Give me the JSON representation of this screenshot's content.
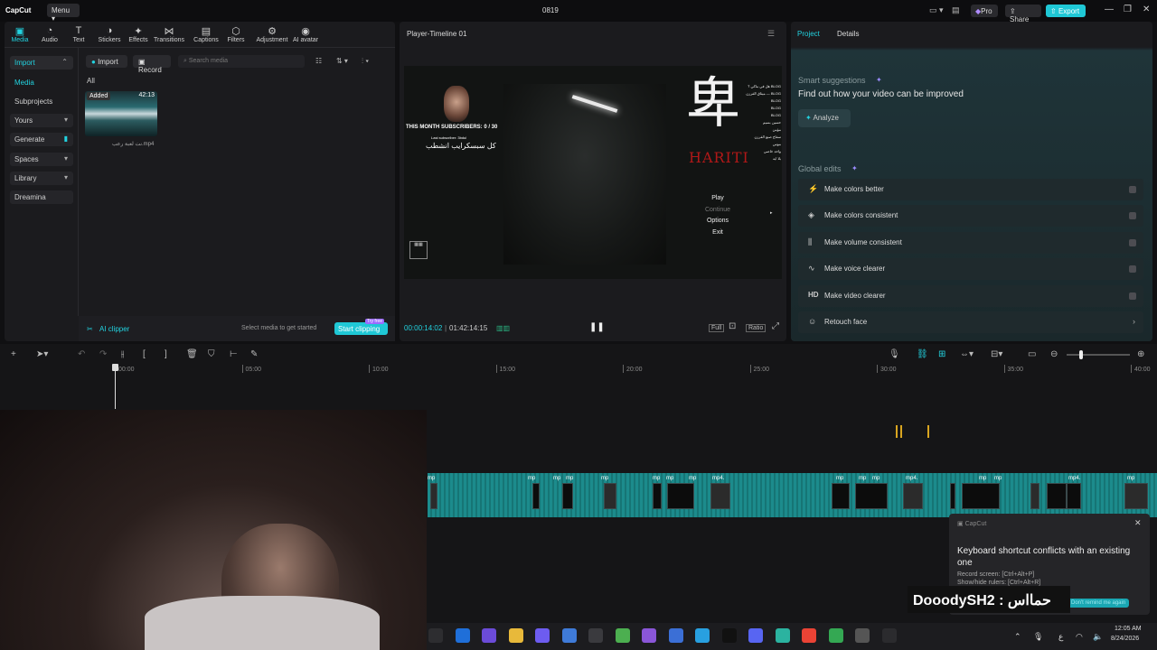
{
  "app": {
    "logo": "CapCut",
    "menu_label": "Menu",
    "project_title": "0819"
  },
  "header_right": {
    "pro_label": "Pro",
    "share_label": "Share",
    "export_label": "Export"
  },
  "toolbar": {
    "items": [
      {
        "label": "Media",
        "icon": "media-icon"
      },
      {
        "label": "Audio",
        "icon": "audio-icon"
      },
      {
        "label": "Text",
        "icon": "text-icon"
      },
      {
        "label": "Stickers",
        "icon": "stickers-icon"
      },
      {
        "label": "Effects",
        "icon": "effects-icon"
      },
      {
        "label": "Transitions",
        "icon": "transitions-icon"
      },
      {
        "label": "Captions",
        "icon": "captions-icon"
      },
      {
        "label": "Filters",
        "icon": "filters-icon"
      },
      {
        "label": "Adjustment",
        "icon": "adjustment-icon"
      },
      {
        "label": "AI avatar",
        "icon": "ai-avatar-icon"
      }
    ]
  },
  "sidebar": {
    "items": [
      {
        "label": "Import"
      },
      {
        "label": "Media"
      },
      {
        "label": "Subprojects"
      },
      {
        "label": "Yours"
      },
      {
        "label": "Generate"
      },
      {
        "label": "Spaces"
      },
      {
        "label": "Library"
      },
      {
        "label": "Dreamina"
      }
    ]
  },
  "media": {
    "import_label": "Import",
    "record_label": "Record",
    "search_placeholder": "Search media",
    "filter_all": "All",
    "clip": {
      "badge": "Added",
      "duration": "42:13",
      "filename": "نت لعبة رعب.mp4"
    },
    "ai_clipper": "AI clipper",
    "hint": "Select media to get started",
    "start_clipping": "Start clipping",
    "try_free": "Try free"
  },
  "player": {
    "title": "Player-Timeline 01",
    "current_time": "00:00:14:02",
    "total_time": "01:42:14:15",
    "ratio_label": "Ratio",
    "full_label": "Full",
    "overlay": {
      "subs_line": "THIS MONTH SUBSCRIBERS: 0 / 30",
      "last_sub": "Last subscriber: 3bdul",
      "arabic_line": "كل سبسكرايب انشطب",
      "game_title": "HARITI",
      "menu": [
        "Play",
        "Continue",
        "Options",
        "Exit"
      ],
      "chat_lines": [
        "هل في ماكي ؟ BLOG",
        "ميثاق الفرزن — BLOG",
        "BLOG",
        "BLOG",
        "BLOG",
        "حسين بسيم",
        "مؤمن",
        "سفاح صنع الفرزن",
        "موس",
        "واحد خاصي",
        "بلا ايه"
      ]
    }
  },
  "right_panel": {
    "tabs": [
      "Project",
      "Details"
    ],
    "smart_title": "Smart suggestions",
    "smart_sub": "Find out how your video can be improved",
    "analyze": "Analyze",
    "global_title": "Global edits",
    "items": [
      {
        "label": "Make colors better",
        "icon": "magic-wand-icon"
      },
      {
        "label": "Make colors consistent",
        "icon": "color-drop-icon"
      },
      {
        "label": "Make volume consistent",
        "icon": "volume-bars-icon"
      },
      {
        "label": "Make voice clearer",
        "icon": "voice-wave-icon"
      },
      {
        "label": "Make video clearer",
        "icon": "hd-icon"
      },
      {
        "label": "Retouch face",
        "icon": "face-icon"
      }
    ],
    "hd_glyph": "HD"
  },
  "timeline": {
    "ruler": [
      "00:00",
      "05:00",
      "10:00",
      "15:00",
      "20:00",
      "25:00",
      "30:00",
      "35:00",
      "40:00"
    ],
    "clip_labels": [
      "mp",
      "mp",
      "mp",
      "mp",
      "mp",
      "mp4.",
      "mp",
      "mp",
      "mp",
      "mp4.",
      "mp",
      "mp",
      "mp",
      "mp",
      "mp",
      "mp4.",
      "mp"
    ]
  },
  "toast": {
    "app": "CapCut",
    "title": "Keyboard shortcut conflicts with an existing one",
    "line1": "Record screen: [Ctrl+Alt+P]",
    "line2": "Show/hide rulers: [Ctrl+Alt+R]",
    "dont_remind": "Don't remind me again"
  },
  "stream_overlay": {
    "name_tag": "DooodySH2 : حمااس"
  },
  "taskbar": {
    "time": "12:05 AM",
    "date": "8/24/2026",
    "lang": "ع"
  },
  "colors": {
    "accent": "#22d3e0",
    "clip_teal": "#1e8f8f",
    "bg": "#101012",
    "panel": "#1b1b1e"
  }
}
